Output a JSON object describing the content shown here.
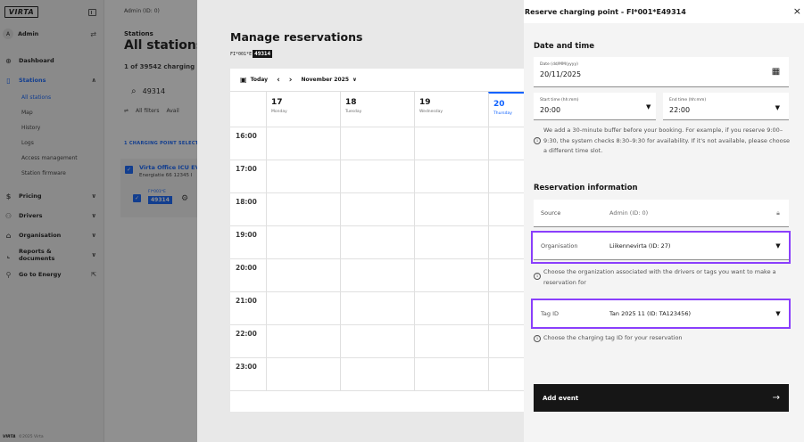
{
  "sidebar": {
    "logo": "VIRTA",
    "user": {
      "avatar": "A",
      "name": "Admin"
    },
    "nav": [
      {
        "icon": "dashboard-icon",
        "glyph": "⊕",
        "label": "Dashboard",
        "chev": ""
      },
      {
        "icon": "stations-icon",
        "glyph": "▯",
        "label": "Stations",
        "chev": "∧"
      },
      {
        "icon": "pricing-icon",
        "glyph": "$",
        "label": "Pricing",
        "chev": "∨"
      },
      {
        "icon": "drivers-icon",
        "glyph": "⚇",
        "label": "Drivers",
        "chev": "∨"
      },
      {
        "icon": "organisation-icon",
        "glyph": "⌂",
        "label": "Organisation",
        "chev": "∨"
      },
      {
        "icon": "reports-icon",
        "glyph": "⌞",
        "label": "Reports & documents",
        "chev": "∨"
      },
      {
        "icon": "energy-icon",
        "glyph": "⚲",
        "label": "Go to Energy",
        "chev": "⇱"
      }
    ],
    "station_sub": [
      "All stations",
      "Map",
      "History",
      "Logs",
      "Access management",
      "Station firmware"
    ],
    "footer_copy": "©2025 Virta"
  },
  "main": {
    "breadcrumb": "Admin (ID: 0)",
    "subtitle": "Stations",
    "title": "All stations",
    "count": "1 of 39542 charging poi",
    "search": "49314",
    "filters": [
      "All filters",
      "Avail"
    ],
    "selected": "1 CHARGING POINT SELECTI",
    "station_name": "Virta Office ICU EV",
    "station_addr": "Energiatie 66 12345 I",
    "point_id": "FI*001*E",
    "point_tag": "49314"
  },
  "reservations": {
    "title": "Manage reservations",
    "id_prefix": "FI*001*E",
    "id_tag": "49314",
    "today": "Today",
    "month": "November 2025",
    "days": [
      {
        "num": "17",
        "name": "Monday"
      },
      {
        "num": "18",
        "name": "Tuesday"
      },
      {
        "num": "19",
        "name": "Wednesday"
      },
      {
        "num": "20",
        "name": "Thursday"
      }
    ],
    "times": [
      "16:00",
      "17:00",
      "18:00",
      "19:00",
      "20:00",
      "21:00",
      "22:00",
      "23:00"
    ]
  },
  "panel": {
    "title": "Reserve charging point - FI*001*E49314",
    "date_section": "Date and time",
    "date_label": "Date (dd/MM/yyyy)",
    "date_value": "20/11/2025",
    "start_label": "Start time (hh:mm)",
    "start_value": "20:00",
    "end_label": "End time (hh:mm)",
    "end_value": "22:00",
    "buffer_note": "We add a 30-minute buffer before your booking. For example, if you reserve 9:00–9:30, the system checks 8:30–9:30 for availability. If it's not available, please choose a different time slot.",
    "res_section": "Reservation information",
    "source_label": "Source",
    "source_value": "Admin (ID: 0)",
    "org_label": "Organisation",
    "org_value": "Liikennevirta (ID: 27)",
    "org_help": "Choose the organization associated with the drivers or tags you want to make a reservation for",
    "tag_label": "Tag ID",
    "tag_value": "Tan 2025 11 (ID: TA123456)",
    "tag_help": "Choose the charging tag ID for your reservation",
    "add_button": "Add event",
    "highlight_color": "#8a3ffc"
  }
}
